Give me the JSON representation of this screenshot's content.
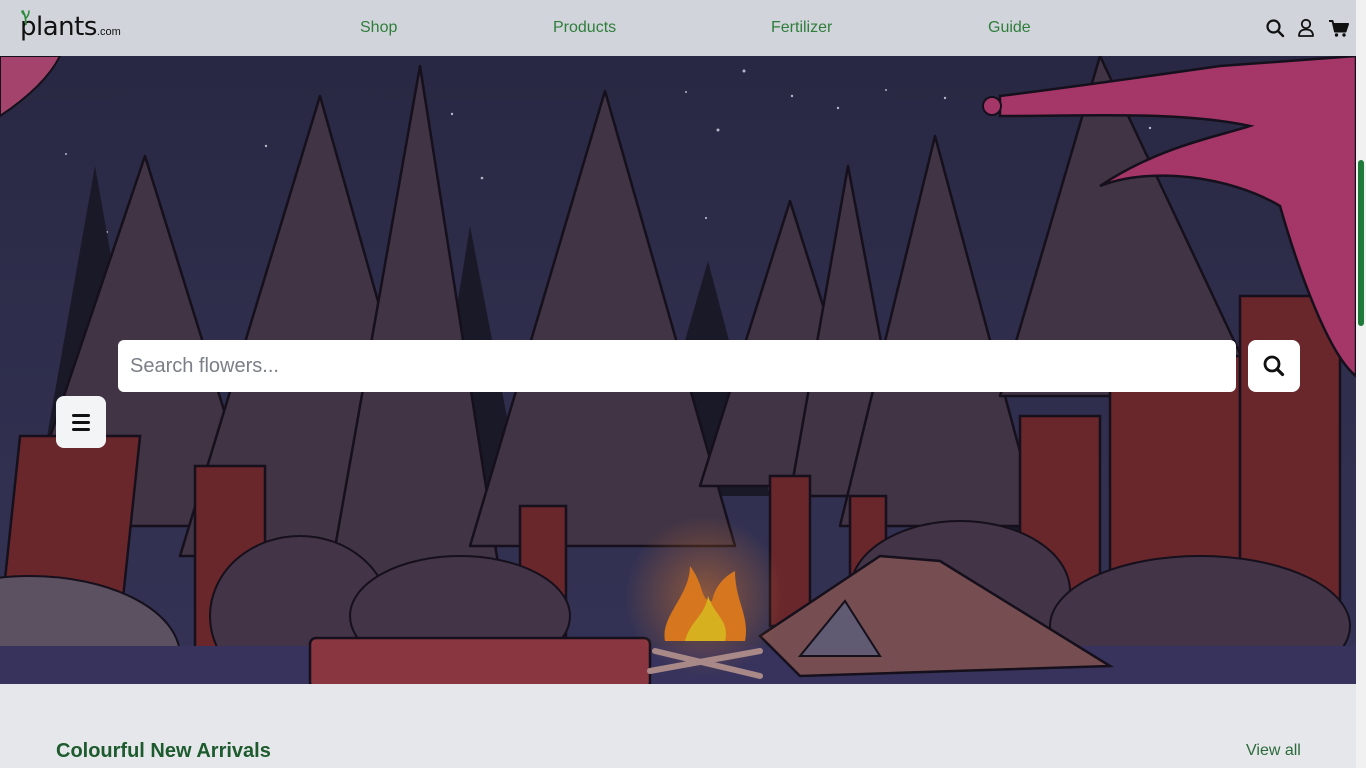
{
  "brand": {
    "name": "plants",
    "domain": ".com"
  },
  "nav": {
    "links": [
      {
        "label": "Shop"
      },
      {
        "label": "Products"
      },
      {
        "label": "Fertilizer"
      },
      {
        "label": "Guide"
      }
    ]
  },
  "header_icons": [
    "search-icon",
    "user-icon",
    "cart-icon"
  ],
  "hero": {
    "scene": "night-campfire-forest",
    "menu_icon": "hamburger-menu-icon",
    "search": {
      "placeholder": "Search flowers...",
      "value": ""
    },
    "search_button_icon": "search-icon"
  },
  "section": {
    "title": "Colourful New Arrivals",
    "view_all": "View all"
  },
  "colors": {
    "header_bg": "#d1d5db",
    "nav_link": "#2f7d3b",
    "page_bg": "#e5e7eb",
    "section_title": "#1d5a2e",
    "scroll_thumb": "#1f7a3b"
  }
}
